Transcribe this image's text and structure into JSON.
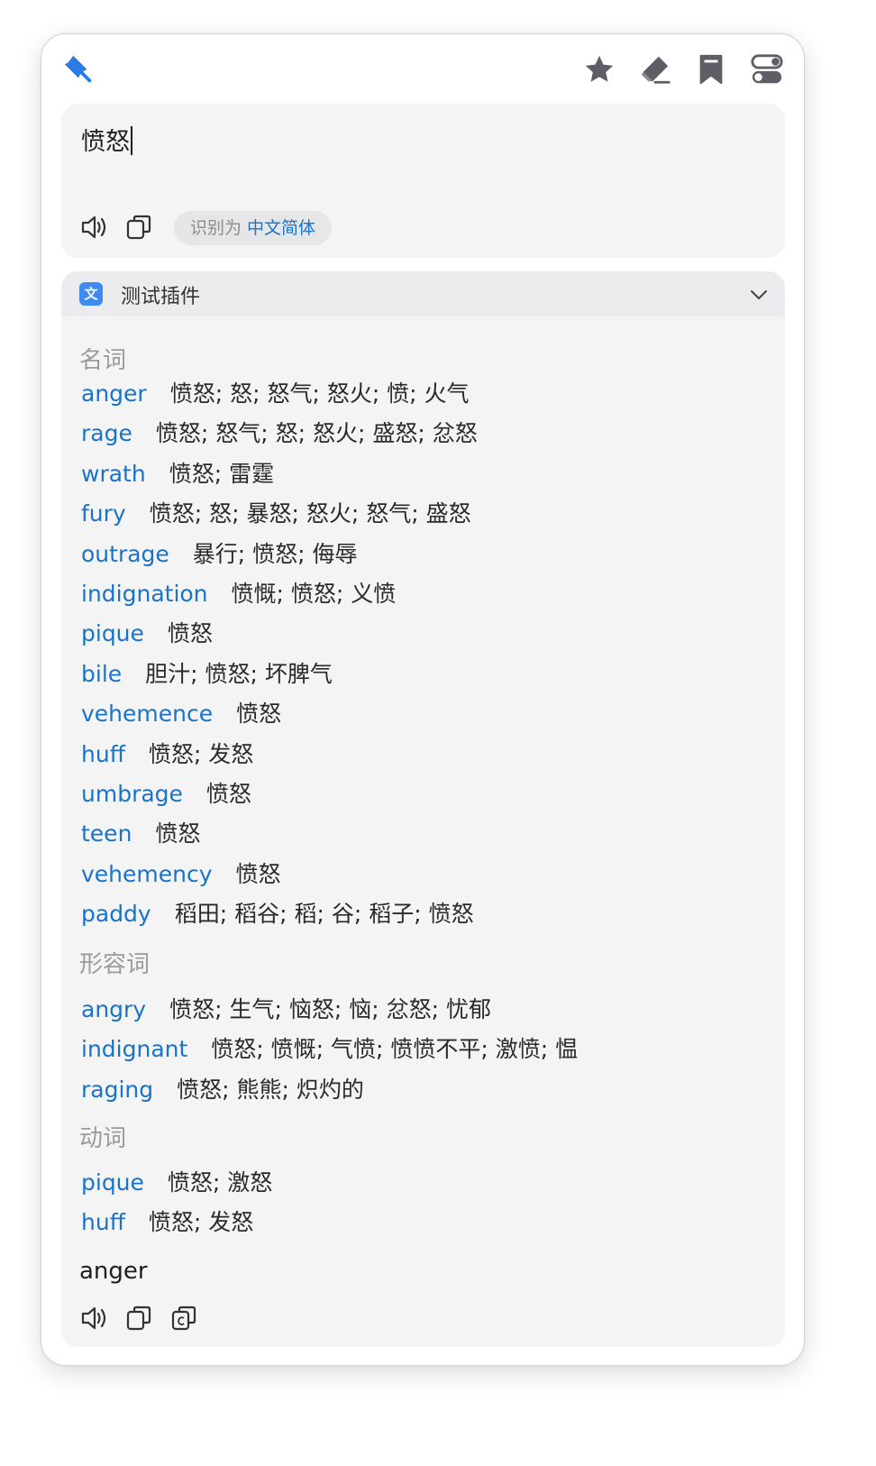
{
  "toolbar": {
    "pin_icon": "pin-icon",
    "actions": [
      "star-icon",
      "eraser-icon",
      "bookmark-icon",
      "toggle-icon"
    ]
  },
  "input": {
    "text": "愤怒",
    "detected_prefix": "识别为",
    "detected_language": "中文简体"
  },
  "result": {
    "plugin_name": "测试插件",
    "plugin_icon_glyph": "文",
    "sections": [
      {
        "pos": "名词",
        "entries": [
          {
            "word": "anger",
            "meaning": "愤怒; 怒; 怒气; 怒火; 愤; 火气"
          },
          {
            "word": "rage",
            "meaning": "愤怒; 怒气; 怒; 怒火; 盛怒; 忿怒"
          },
          {
            "word": "wrath",
            "meaning": "愤怒; 雷霆"
          },
          {
            "word": "fury",
            "meaning": "愤怒; 怒; 暴怒; 怒火; 怒气; 盛怒"
          },
          {
            "word": "outrage",
            "meaning": "暴行; 愤怒; 侮辱"
          },
          {
            "word": "indignation",
            "meaning": "愤慨; 愤怒; 义愤"
          },
          {
            "word": "pique",
            "meaning": "愤怒"
          },
          {
            "word": "bile",
            "meaning": "胆汁; 愤怒; 坏脾气"
          },
          {
            "word": "vehemence",
            "meaning": "愤怒"
          },
          {
            "word": "huff",
            "meaning": "愤怒; 发怒"
          },
          {
            "word": "umbrage",
            "meaning": "愤怒"
          },
          {
            "word": "teen",
            "meaning": "愤怒"
          },
          {
            "word": "vehemency",
            "meaning": "愤怒"
          },
          {
            "word": "paddy",
            "meaning": "稻田; 稻谷; 稻; 谷; 稻子; 愤怒"
          }
        ]
      },
      {
        "pos": "形容词",
        "entries": [
          {
            "word": "angry",
            "meaning": "愤怒; 生气; 恼怒; 恼; 忿怒; 忧郁"
          },
          {
            "word": "indignant",
            "meaning": "愤怒; 愤慨; 气愤; 愤愤不平; 激愤; 愠"
          },
          {
            "word": "raging",
            "meaning": "愤怒; 熊熊; 炽灼的"
          }
        ]
      },
      {
        "pos": "动词",
        "entries": [
          {
            "word": "pique",
            "meaning": "愤怒; 激怒"
          },
          {
            "word": "huff",
            "meaning": "愤怒; 发怒"
          }
        ]
      }
    ],
    "translated_text": "anger"
  },
  "colors": {
    "accent": "#1a73c9",
    "card_bg": "#f4f4f5",
    "header_bg": "#ececee",
    "plugin_icon_bg": "#3d8af0",
    "pos_label": "#9a9a9a"
  }
}
